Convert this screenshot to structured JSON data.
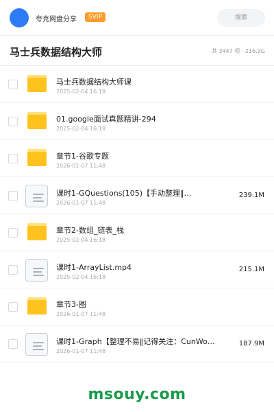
{
  "header": {
    "user_name": "夸克网盘分享",
    "badge": "SVIP",
    "search_placeholder": "搜索",
    "colors": {
      "avatar": "#2f7bf5",
      "badge": "#ff9c2b"
    }
  },
  "title_row": {
    "title": "马士兵数据结构大师",
    "summary": "共 3447 项 · 216.9G"
  },
  "files": [
    {
      "type": "folder",
      "icon": "folder-icon",
      "name": "马士兵数据结构大师课",
      "date": "2025-02-04 16:18",
      "size": ""
    },
    {
      "type": "folder",
      "icon": "folder-icon",
      "name": "01.google面试真题精讲-294",
      "date": "2025-02-04 16:18",
      "size": ""
    },
    {
      "type": "folder",
      "icon": "folder-icon",
      "name": "章节1-谷歌专题",
      "date": "2026-01-07 11:48",
      "size": ""
    },
    {
      "type": "file",
      "icon": "document-icon",
      "name": "课时1-GQuestions(105)【手动整理‖…",
      "date": "2026-01-07 11:48",
      "size": "239.1M"
    },
    {
      "type": "folder",
      "icon": "folder-icon",
      "name": "章节2-数组_链表_栈",
      "date": "2025-02-04 16:18",
      "size": ""
    },
    {
      "type": "file",
      "icon": "document-icon",
      "name": "课时1-ArrayList.mp4",
      "date": "2025-02-04 16:18",
      "size": "215.1M"
    },
    {
      "type": "folder",
      "icon": "folder-icon",
      "name": "章节3-图",
      "date": "2026-01-07 11:48",
      "size": ""
    },
    {
      "type": "file",
      "icon": "document-icon",
      "name": "课时1-Graph【整理不易‖记得关注：CunWo…",
      "date": "2026-01-07 11:48",
      "size": "187.9M"
    }
  ],
  "footer": {
    "watermark": "msouy.com",
    "colors": {
      "watermark": "#1a9a4a"
    }
  }
}
